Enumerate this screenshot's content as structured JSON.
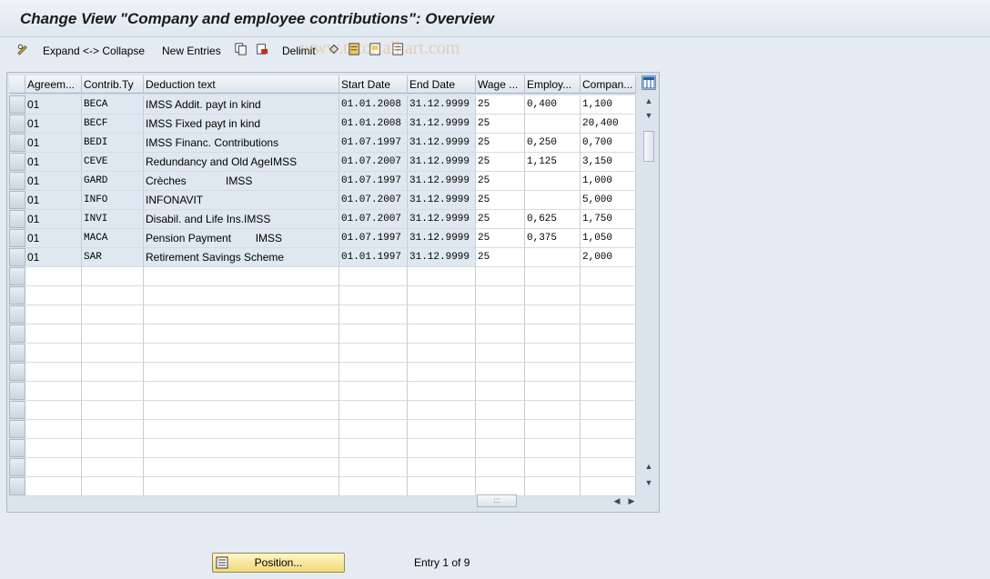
{
  "title": "Change View \"Company and employee contributions\": Overview",
  "toolbar": {
    "expand_collapse": "Expand <-> Collapse",
    "new_entries": "New Entries",
    "delimit": "Delimit"
  },
  "watermark": "www.tutorialkart.com",
  "table": {
    "columns": [
      "Agreem...",
      "Contrib.Ty",
      "Deduction text",
      "Start Date",
      "End Date",
      "Wage ...",
      "Employ...",
      "Compan..."
    ],
    "rows": [
      [
        "01",
        "BECA",
        "IMSS Addit. payt in kind",
        "01.01.2008",
        "31.12.9999",
        "25",
        "0,400",
        "1,100"
      ],
      [
        "01",
        "BECF",
        "IMSS Fixed payt in kind",
        "01.01.2008",
        "31.12.9999",
        "25",
        "",
        "20,400"
      ],
      [
        "01",
        "BEDI",
        "IMSS Financ. Contributions",
        "01.07.1997",
        "31.12.9999",
        "25",
        "0,250",
        "0,700"
      ],
      [
        "01",
        "CEVE",
        "Redundancy and Old AgeIMSS",
        "01.07.2007",
        "31.12.9999",
        "25",
        "1,125",
        "3,150"
      ],
      [
        "01",
        "GARD",
        "Crèches             IMSS",
        "01.07.1997",
        "31.12.9999",
        "25",
        "",
        "1,000"
      ],
      [
        "01",
        "INFO",
        "INFONAVIT",
        "01.07.2007",
        "31.12.9999",
        "25",
        "",
        "5,000"
      ],
      [
        "01",
        "INVI",
        "Disabil. and Life Ins.IMSS",
        "01.07.2007",
        "31.12.9999",
        "25",
        "0,625",
        "1,750"
      ],
      [
        "01",
        "MACA",
        "Pension Payment        IMSS",
        "01.07.1997",
        "31.12.9999",
        "25",
        "0,375",
        "1,050"
      ],
      [
        "01",
        "SAR",
        "Retirement Savings Scheme",
        "01.01.1997",
        "31.12.9999",
        "25",
        "",
        "2,000"
      ]
    ],
    "empty_rows": 12
  },
  "position_button": "Position...",
  "entry_info": "Entry 1 of 9",
  "colors": {
    "background": "#e4ebf2",
    "readonly_cell": "#dfe8f0",
    "input_cell": "#ffffff",
    "button_yellow": "#f2d97a"
  },
  "icons": {
    "toolbar": [
      "pencil-glasses-icon",
      "copy-icon",
      "delete-icon",
      "delimit-icon",
      "undo-icon",
      "select-all-icon",
      "select-block-icon",
      "deselect-all-icon"
    ],
    "position": "position-icon",
    "column_settings": "table-settings-icon"
  }
}
